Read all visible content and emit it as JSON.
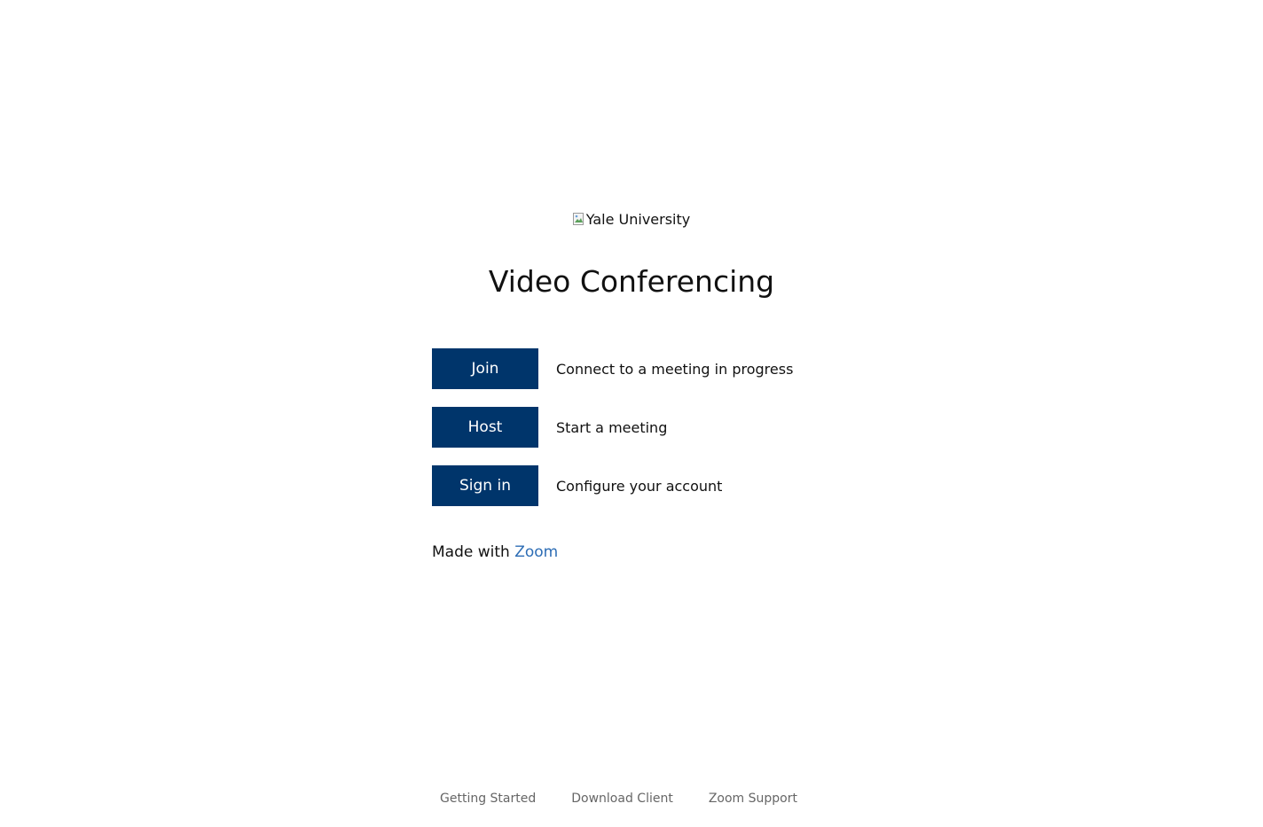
{
  "logo": {
    "alt_text": "Yale University",
    "icon": "broken-image-icon"
  },
  "title": "Video Conferencing",
  "actions": [
    {
      "label": "Join",
      "description": "Connect to a meeting in progress"
    },
    {
      "label": "Host",
      "description": "Start a meeting"
    },
    {
      "label": "Sign in",
      "description": "Configure your account"
    }
  ],
  "made_with": {
    "prefix": "Made with",
    "link_label": "Zoom"
  },
  "footer": {
    "links": [
      "Getting Started",
      "Download Client",
      "Zoom Support"
    ]
  },
  "colors": {
    "button_bg": "#00356b",
    "button_text": "#ffffff",
    "link": "#2d6db5",
    "footer_link": "#666666"
  }
}
